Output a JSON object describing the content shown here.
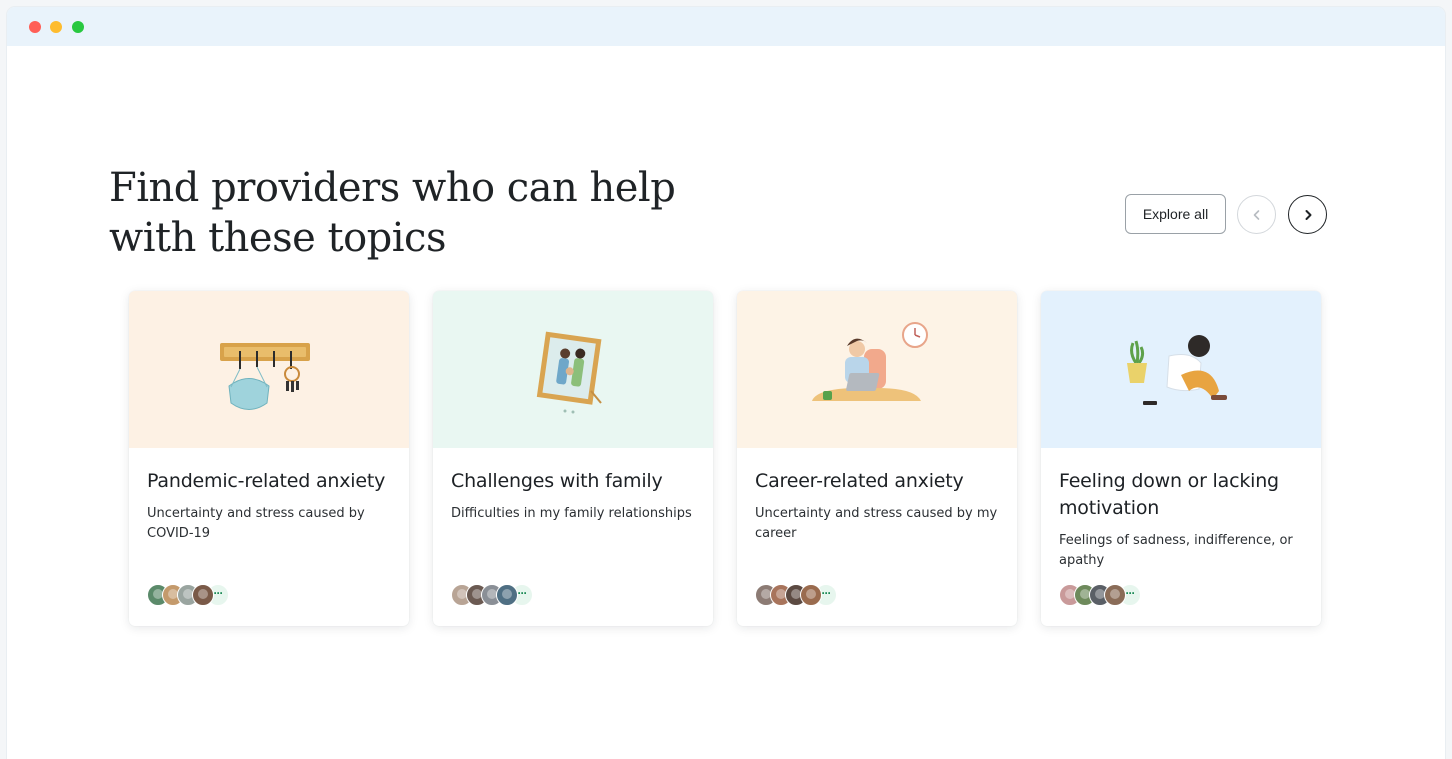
{
  "section": {
    "heading": "Find providers who can help with these topics",
    "explore_label": "Explore all"
  },
  "icons": {
    "prev": "chevron-left-icon",
    "next": "chevron-right-icon",
    "more": "more-dots-icon"
  },
  "colors": {
    "card1_bg": "#fdf1e4",
    "card2_bg": "#e9f7f2",
    "card3_bg": "#fdf3e6",
    "card4_bg": "#e3f1fd",
    "accent_green": "#1b8a55"
  },
  "cards": [
    {
      "title": "Pandemic-related anxiety",
      "description": "Uncertainty and stress caused by COVID-19",
      "more_label": "···"
    },
    {
      "title": "Challenges with family",
      "description": "Difficulties in my family relationships",
      "more_label": "···"
    },
    {
      "title": "Career-related anxiety",
      "description": "Uncertainty and stress caused by my career",
      "more_label": "···"
    },
    {
      "title": "Feeling down or lacking motivation",
      "description": "Feelings of sadness, indifference, or apathy",
      "more_label": "···"
    }
  ]
}
